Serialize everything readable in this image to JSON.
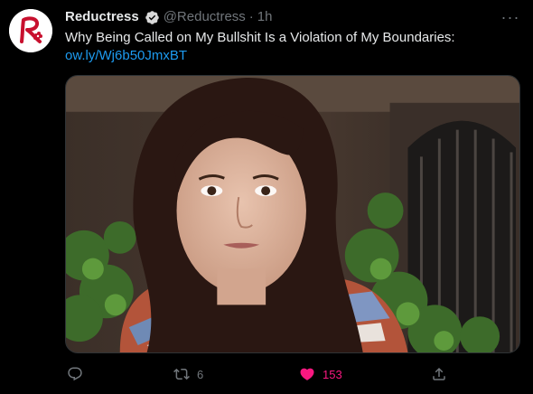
{
  "tweet": {
    "display_name": "Reductress",
    "handle": "@Reductress",
    "separator": "·",
    "time": "1h",
    "text": "Why Being Called on My Bullshit Is a Violation of My Boundaries:",
    "link": "ow.ly/Wj6b50JmxBT",
    "more_label": "···"
  },
  "actions": {
    "reply_count": "",
    "retweet_count": "6",
    "like_count": "153"
  },
  "colors": {
    "background": "#000000",
    "text": "#e7e9ea",
    "muted": "#71767b",
    "link": "#1d9bf0",
    "like": "#f91880",
    "brand": "#c8102e"
  },
  "icons": {
    "avatar": "reductress-logo",
    "verified": "verified-badge-icon",
    "reply": "reply-icon",
    "retweet": "retweet-icon",
    "like": "heart-icon",
    "share": "share-icon"
  }
}
